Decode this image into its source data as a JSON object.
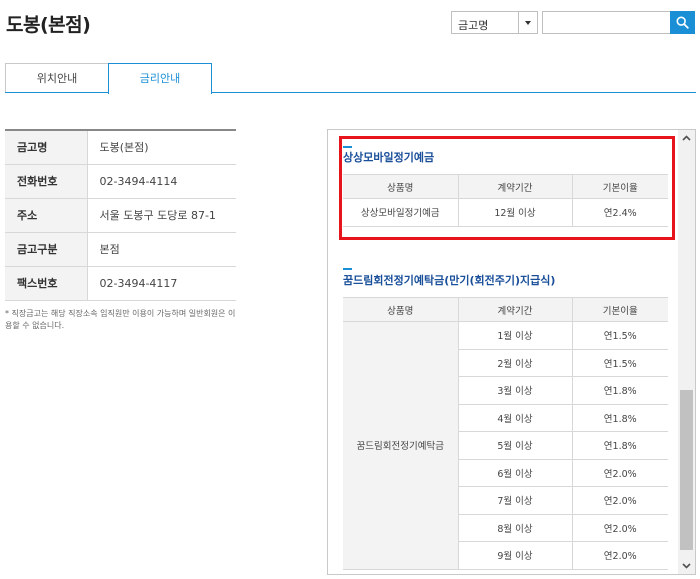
{
  "page": {
    "title": "도봉(본점)"
  },
  "search": {
    "select_value": "금고명",
    "input_placeholder": ""
  },
  "tabs": [
    {
      "label": "위치안내",
      "active": false
    },
    {
      "label": "금리안내",
      "active": true
    }
  ],
  "info": {
    "rows": [
      {
        "label": "금고명",
        "value": "도봉(본점)"
      },
      {
        "label": "전화번호",
        "value": "02-3494-4114"
      },
      {
        "label": "주소",
        "value": "서울 도봉구 도당로 87-1"
      },
      {
        "label": "금고구분",
        "value": "본점"
      },
      {
        "label": "팩스번호",
        "value": "02-3494-4117"
      }
    ],
    "note": "* 직장금고는 해당 직장소속 임직원만 이용이 가능하며 일반회원은 이용할 수 없습니다."
  },
  "rates": {
    "headers": [
      "상품명",
      "계약기간",
      "기본이율"
    ],
    "sections": [
      {
        "title": "상상모바일정기예금",
        "product": "상상모바일정기예금",
        "rows": [
          {
            "period": "12월 이상",
            "rate": "연2.4%"
          }
        ]
      },
      {
        "title": "꿈드림회전정기예탁금(만기(회전주기)지급식)",
        "product": "꿈드림회전정기예탁금",
        "rows": [
          {
            "period": "1월 이상",
            "rate": "연1.5%"
          },
          {
            "period": "2월 이상",
            "rate": "연1.5%"
          },
          {
            "period": "3월 이상",
            "rate": "연1.8%"
          },
          {
            "period": "4월 이상",
            "rate": "연1.8%"
          },
          {
            "period": "5월 이상",
            "rate": "연1.8%"
          },
          {
            "period": "6월 이상",
            "rate": "연2.0%"
          },
          {
            "period": "7월 이상",
            "rate": "연2.0%"
          },
          {
            "period": "8월 이상",
            "rate": "연2.0%"
          },
          {
            "period": "9월 이상",
            "rate": "연2.0%"
          }
        ]
      }
    ]
  },
  "colors": {
    "accent": "#1a8fd6",
    "highlight": "#e8141b",
    "section_title": "#1a4f9a"
  },
  "icons": {
    "search": "search-icon",
    "dropdown": "caret-down-icon",
    "scroll_up": "chevron-up-icon",
    "scroll_down": "chevron-down-icon"
  }
}
